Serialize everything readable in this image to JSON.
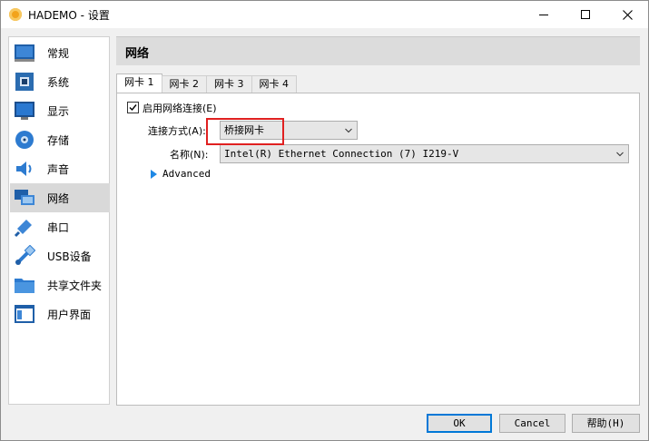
{
  "window": {
    "title": "HADEMO - 设置"
  },
  "sidebar": {
    "items": [
      {
        "label": "常规",
        "icon": "general-icon"
      },
      {
        "label": "系统",
        "icon": "system-icon"
      },
      {
        "label": "显示",
        "icon": "display-icon"
      },
      {
        "label": "存储",
        "icon": "storage-icon"
      },
      {
        "label": "声音",
        "icon": "audio-icon"
      },
      {
        "label": "网络",
        "icon": "network-icon",
        "selected": true
      },
      {
        "label": "串口",
        "icon": "serial-port-icon"
      },
      {
        "label": "USB设备",
        "icon": "usb-icon"
      },
      {
        "label": "共享文件夹",
        "icon": "shared-folder-icon"
      },
      {
        "label": "用户界面",
        "icon": "user-interface-icon"
      }
    ]
  },
  "main": {
    "title": "网络",
    "tabs": [
      "网卡 1",
      "网卡 2",
      "网卡 3",
      "网卡 4"
    ],
    "enable_label": "启用网络连接(E)",
    "enabled": true,
    "attached_label": "连接方式(A):",
    "attached_value": "桥接网卡",
    "name_label": "名称(N):",
    "name_value": "Intel(R) Ethernet Connection (7) I219-V",
    "advanced_label": "Advanced"
  },
  "buttons": {
    "ok": "OK",
    "cancel": "Cancel",
    "help": "帮助(H)"
  },
  "colors": {
    "accent": "#0078d7",
    "highlight": "#e02020"
  }
}
